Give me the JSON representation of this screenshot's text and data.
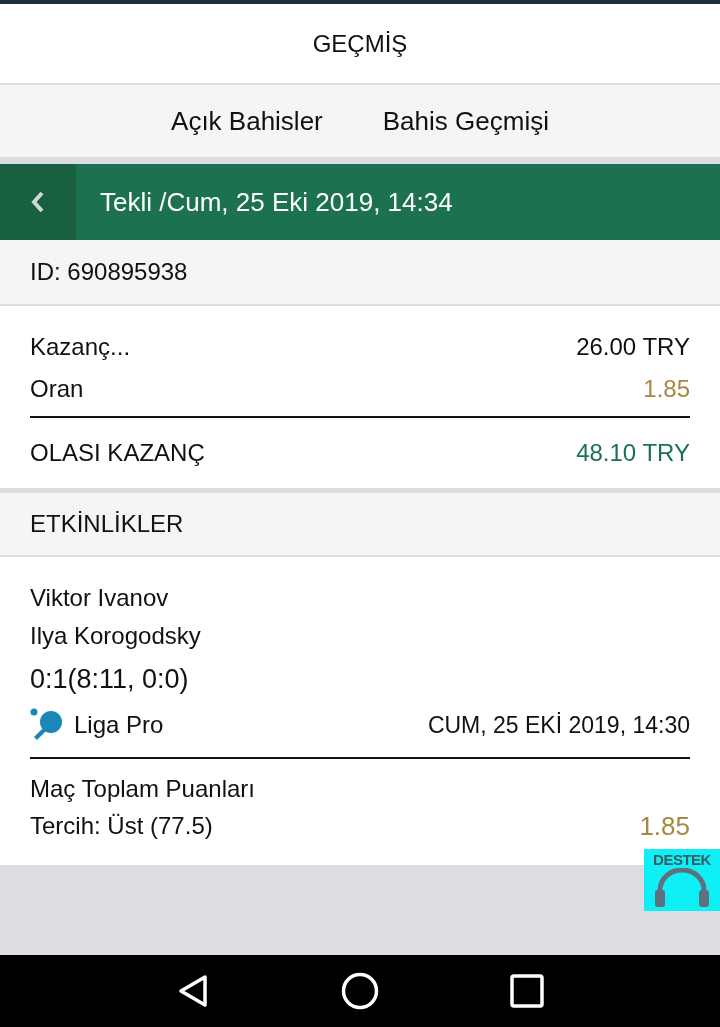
{
  "header": {
    "title": "GEÇMİŞ"
  },
  "tabs": [
    {
      "label": "Açık Bahisler"
    },
    {
      "label": "Bahis Geçmişi"
    }
  ],
  "bet_bar": {
    "title": "Tekli /Cum, 25 Eki 2019, 14:34"
  },
  "bet_id": "ID: 690895938",
  "summary": {
    "stake_label": "Kazanç...",
    "stake_value": "26.00 TRY",
    "odds_label": "Oran",
    "odds_value": "1.85",
    "win_label": "OLASI KAZANÇ",
    "win_value": "48.10 TRY"
  },
  "events_title": "ETKİNLİKLER",
  "event": {
    "home": "Viktor Ivanov",
    "away": "Ilya Korogodsky",
    "score": "0:1(8:11, 0:0)",
    "league": "Liga Pro",
    "datetime": "CUM, 25 EKİ 2019, 14:30",
    "market": "Maç Toplam Puanları",
    "pick": "Tercih: Üst (77.5)",
    "odds": "1.85"
  },
  "support": {
    "label": "DESTEK"
  }
}
